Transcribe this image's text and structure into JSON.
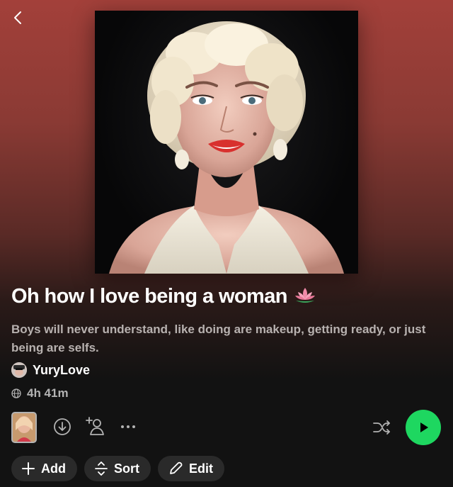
{
  "header": {
    "back_icon": "chevron-left-icon"
  },
  "playlist": {
    "title": "Oh how I love being a woman",
    "title_emoji": "lotus-icon",
    "description": "Boys will never understand, like doing are makeup, getting ready, or just being are selfs.",
    "owner": "YuryLove",
    "duration": "4h 41m"
  },
  "actions": {
    "download_icon": "download-icon",
    "add_user_icon": "add-user-icon",
    "more_icon": "more-icon",
    "shuffle_icon": "shuffle-icon",
    "play_icon": "play-icon"
  },
  "chips": {
    "add_label": "Add",
    "sort_label": "Sort",
    "edit_label": "Edit"
  },
  "colors": {
    "accent": "#1ed760",
    "background": "#121212",
    "header_gradient_top": "#a3403a",
    "chip_bg": "#2a2a2a",
    "muted_text": "#b3b3b3"
  }
}
